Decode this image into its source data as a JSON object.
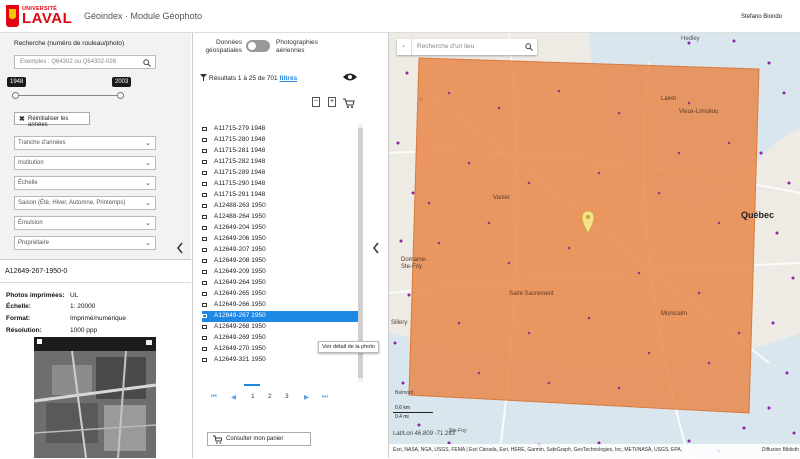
{
  "header": {
    "logo_small": "UNIVERSITÉ",
    "logo_big": "LAVAL",
    "app_title": "Géoindex · Module Géophoto",
    "user": "Stefano Biondo"
  },
  "search": {
    "label": "Recherche (numéro de rouleau/photo)",
    "placeholder": "Exemples : Q64302 ou Q64302-026",
    "year_min": "1948",
    "year_max": "2003",
    "reset_label": "Réinitialiser les années",
    "filters": [
      "Tranche d'années",
      "Institution",
      "Échelle",
      "Saison (Été, Hiver, Automne, Printemps)",
      "Émulsion",
      "Propriétaire"
    ]
  },
  "details": {
    "photo_id": "A12649-267-1950-0",
    "rows": [
      {
        "k": "Photos imprimées:",
        "v": "UL"
      },
      {
        "k": "Échelle:",
        "v": "1: 20000"
      },
      {
        "k": "Format:",
        "v": "Imprimé/numérique"
      },
      {
        "k": "Résolution:",
        "v": "1000 ppp"
      }
    ]
  },
  "middle": {
    "toggle_left": "Données géospatiales",
    "toggle_right": "Photographies aériennes",
    "results_text": "Résultats 1 à 25 de 701",
    "results_link": "filtrés",
    "items": [
      "A11715-279 1948",
      "A11715-280 1948",
      "A11715-281 1948",
      "A11715-282 1948",
      "A11715-289 1948",
      "A11715-290 1948",
      "A11715-291 1948",
      "A12488-263 1950",
      "A12488-264 1950",
      "A12649-204 1950",
      "A12649-206 1950",
      "A12649-207 1950",
      "A12649-208 1950",
      "A12649-209 1950",
      "A12649-264 1950",
      "A12649-265 1950",
      "A12649-266 1950",
      "A12649-267 1950",
      "A12649-268 1950",
      "A12649-269 1950",
      "A12649-270 1950",
      "A12649-321 1950"
    ],
    "selected_index": 17,
    "tooltip": "Voir détail de la photo",
    "pages": [
      "1",
      "2",
      "3"
    ],
    "cart_label": "Consulter mon panier"
  },
  "map": {
    "search_placeholder": "Recherche d'un lieu",
    "places": [
      "Hedley",
      "Lairet",
      "Vieux-Limoilou",
      "Vanier",
      "Québec",
      "Domaine-Ste-Foy",
      "Saint-Sacrement",
      "Montcalm",
      "Sillery",
      "Belmont",
      "Ste-Foy"
    ],
    "scale_km": "0.6 km",
    "scale_mi": "0.4 mi",
    "coords": "Lat/Lon 46.809 -71.283",
    "attribution": "Esri, NASA, NGA, USGS, FEMA | Esri Canada, Esri, HERE, Garmin, SafeGraph, GeoTechnologies, Inc, METI/NASA, USGS, EPA,",
    "diffusion": "Diffusion Biblioth",
    "footprint_color": "#e8874a",
    "point_color": "#9c27b0"
  }
}
